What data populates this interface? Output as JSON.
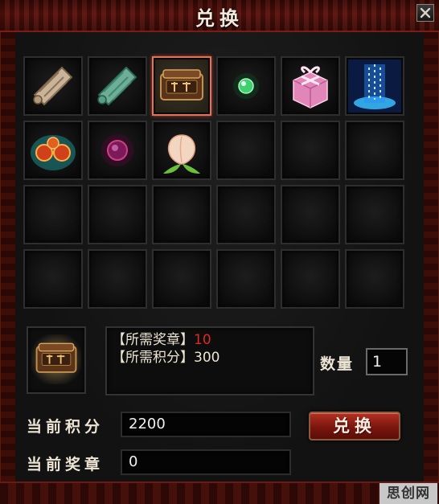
{
  "window": {
    "title": "兑换"
  },
  "grid": {
    "rows": 4,
    "columns": 6,
    "selected_index": 2,
    "items": [
      {
        "icon": "parchment-scroll-icon"
      },
      {
        "icon": "jade-scroll-icon"
      },
      {
        "icon": "treasure-box-icon"
      },
      {
        "icon": "green-orb-icon"
      },
      {
        "icon": "pink-gift-box-icon"
      },
      {
        "icon": "blue-light-pillar-icon"
      },
      {
        "icon": "fire-orbs-icon"
      },
      {
        "icon": "purple-orb-icon"
      },
      {
        "icon": "immortal-peach-icon"
      }
    ]
  },
  "detail": {
    "icon": "treasure-box-icon",
    "required_badge_label": "【所需奖章】",
    "required_badge_value": "10",
    "required_points_label": "【所需积分】",
    "required_points_value": "300"
  },
  "quantity": {
    "label": "数量",
    "value": "1"
  },
  "current_points": {
    "label": "当前积分",
    "value": "2200"
  },
  "current_badges": {
    "label": "当前奖章",
    "value": "0"
  },
  "exchange_button": {
    "label": "兑换"
  },
  "watermark": {
    "text": "思创网"
  },
  "colors": {
    "title_bar": "#5c120c",
    "required_badge_value": "#e0281e",
    "selected_slot_border": "#e0735a",
    "button_red": "#b43022"
  }
}
